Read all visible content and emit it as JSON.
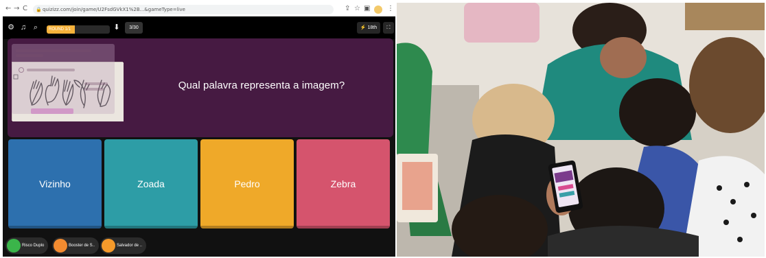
{
  "browser": {
    "url": "quizizz.com/join/game/U2FsdGVkX1%2B...&gameType=live",
    "back_glyph": "←",
    "forward_glyph": "→",
    "reload_glyph": "C",
    "share_glyph": "⇪",
    "star_glyph": "☆",
    "window_glyph": "▣",
    "menu_glyph": "⋮"
  },
  "quiz": {
    "top_bar": {
      "settings_glyph": "⚙",
      "music_glyph": "♫",
      "zoom_glyph": "⌕",
      "progress_label": "ROUND 1/1",
      "progress_fraction": 0.45,
      "progress_color": "#f7b23b",
      "download_glyph": "⬇",
      "counter": "3/30",
      "streak_label": "⚡ 18th",
      "fullscreen_glyph": "⛶"
    },
    "question": {
      "text": "Qual palavra representa a imagem?",
      "overlay_title": "Quizizz: o que o jogo pode ser feito (Alto Vizinhos)",
      "overlay_status": "Responda a questão",
      "image_description_icon": "hand-signs-image"
    },
    "answers": [
      {
        "label": "Vizinho",
        "color": "#2d70ae"
      },
      {
        "label": "Zoada",
        "color": "#2d9da6"
      },
      {
        "label": "Pedro",
        "color": "#efa929"
      },
      {
        "label": "Zebra",
        "color": "#d5546d"
      }
    ],
    "powerups": [
      {
        "label": "Risco Duplo",
        "color": "#3bb54a"
      },
      {
        "label": "Booster de S..",
        "color": "#f28b30"
      },
      {
        "label": "Salvador de ..",
        "color": "#f59a2b"
      }
    ]
  },
  "colors": {
    "card_bg": "#461a42",
    "top_bar_bg": "#000000"
  }
}
